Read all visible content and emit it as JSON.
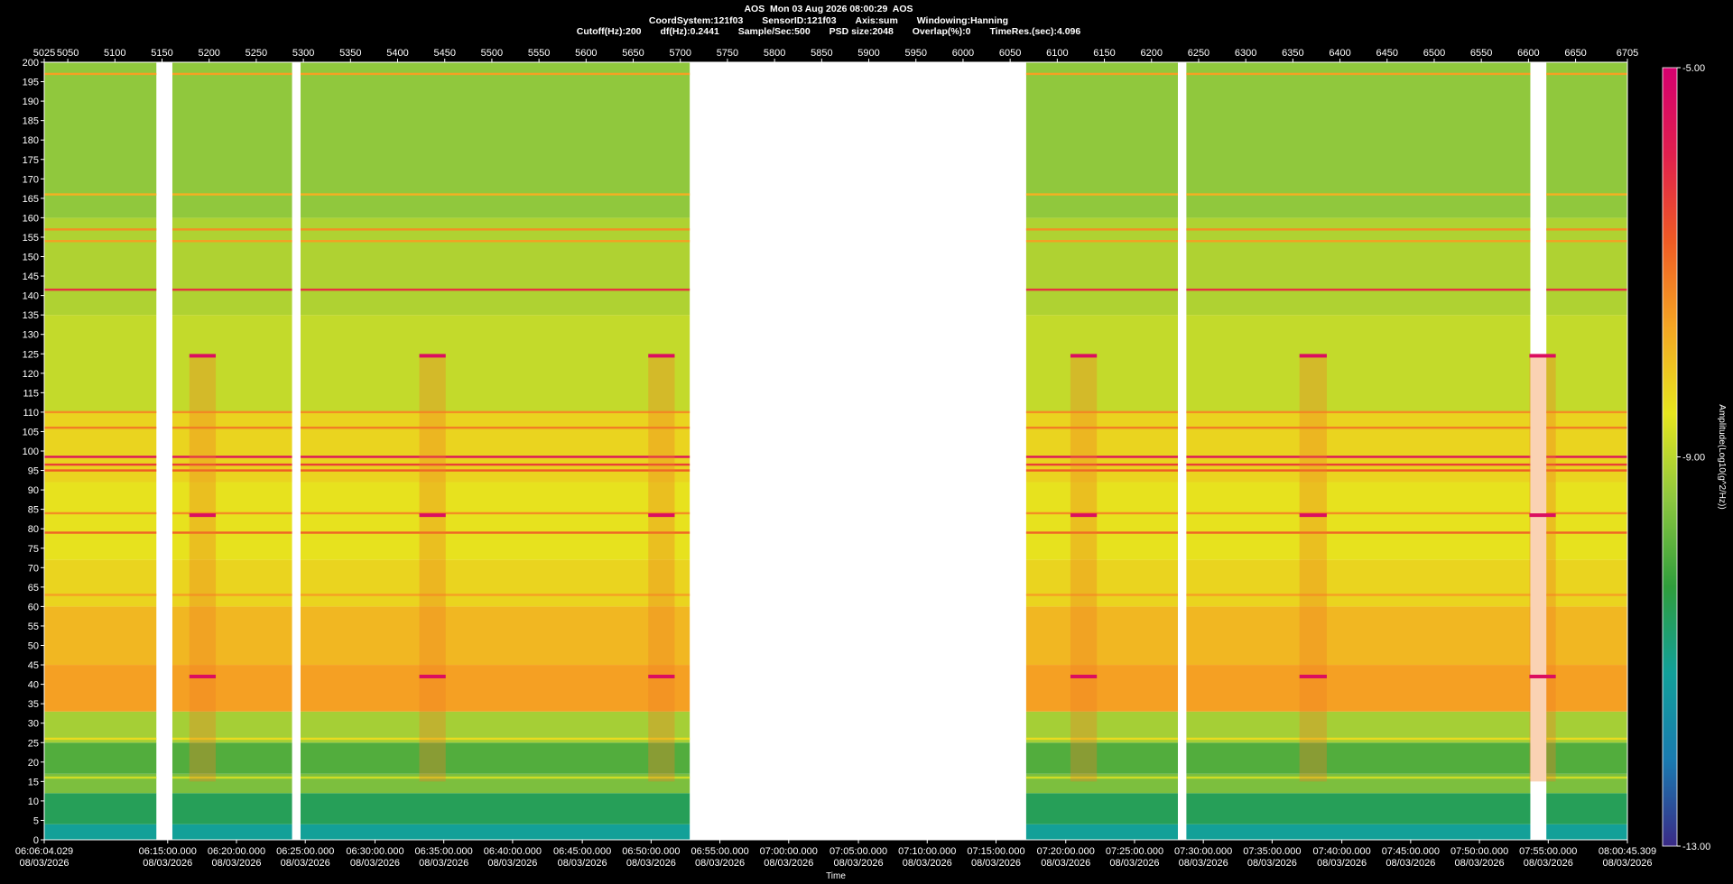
{
  "header": {
    "line1": "AOS  Mon 03 Aug 2026 08:00:29  AOS",
    "line2": [
      "CoordSystem:121f03",
      "SensorID:121f03",
      "Axis:sum",
      "Windowing:Hanning"
    ],
    "line3": [
      "Cutoff(Hz):200",
      "df(Hz):0.2441",
      "Sample/Sec:500",
      "PSD size:2048",
      "Overlap(%):0",
      "TimeRes.(sec):4.096"
    ]
  },
  "chart_data": {
    "type": "heatmap",
    "title": "AOS  Mon 03 Aug 2026 08:00:29  AOS",
    "xlabel": "Time",
    "ylabel": "",
    "colorbar_label": "Amplitude(Log10(g^2/Hz))",
    "colorbar_ticks": [
      "-5.00",
      "-9.00",
      "-13.00"
    ],
    "colorbar_range": [
      -13,
      -5
    ],
    "colorscale": [
      "#3a2a86",
      "#1a7bb0",
      "#12a09a",
      "#2f9e3c",
      "#8cc63f",
      "#e6e61e",
      "#f5a623",
      "#ef5a24",
      "#e01f4e",
      "#d6006f"
    ],
    "ylim": [
      0,
      200
    ],
    "y_ticks": [
      0,
      5,
      10,
      15,
      20,
      25,
      30,
      35,
      40,
      45,
      50,
      55,
      60,
      65,
      70,
      75,
      80,
      85,
      90,
      95,
      100,
      105,
      110,
      115,
      120,
      125,
      130,
      135,
      140,
      145,
      150,
      155,
      160,
      165,
      170,
      175,
      180,
      185,
      190,
      195,
      200
    ],
    "top_axis_range": [
      5025,
      6705
    ],
    "top_ticks": [
      "5025",
      "5050",
      "5100",
      "5150",
      "5200",
      "5250",
      "5300",
      "5350",
      "5400",
      "5450",
      "5500",
      "5550",
      "5600",
      "5650",
      "5700",
      "5750",
      "5800",
      "5850",
      "5900",
      "5950",
      "6000",
      "6050",
      "6100",
      "6150",
      "6200",
      "6250",
      "6300",
      "6350",
      "6400",
      "6450",
      "6500",
      "6550",
      "6600",
      "6650",
      "6705"
    ],
    "time_labels": [
      {
        "time": "06:06:04.029",
        "date": "08/03/2026",
        "pos": 5025
      },
      {
        "time": "06:15:00.000",
        "date": "08/03/2026",
        "pos": 5156
      },
      {
        "time": "06:20:00.000",
        "date": "08/03/2026",
        "pos": 5229
      },
      {
        "time": "06:25:00.000",
        "date": "08/03/2026",
        "pos": 5302
      },
      {
        "time": "06:30:00.000",
        "date": "08/03/2026",
        "pos": 5376
      },
      {
        "time": "06:35:00.000",
        "date": "08/03/2026",
        "pos": 5449
      },
      {
        "time": "06:40:00.000",
        "date": "08/03/2026",
        "pos": 5522
      },
      {
        "time": "06:45:00.000",
        "date": "08/03/2026",
        "pos": 5596
      },
      {
        "time": "06:50:00.000",
        "date": "08/03/2026",
        "pos": 5669
      },
      {
        "time": "06:55:00.000",
        "date": "08/03/2026",
        "pos": 5742
      },
      {
        "time": "07:00:00.000",
        "date": "08/03/2026",
        "pos": 5815
      },
      {
        "time": "07:05:00.000",
        "date": "08/03/2026",
        "pos": 5889
      },
      {
        "time": "07:10:00.000",
        "date": "08/03/2026",
        "pos": 5962
      },
      {
        "time": "07:15:00.000",
        "date": "08/03/2026",
        "pos": 6035
      },
      {
        "time": "07:20:00.000",
        "date": "08/03/2026",
        "pos": 6109
      },
      {
        "time": "07:25:00.000",
        "date": "08/03/2026",
        "pos": 6182
      },
      {
        "time": "07:30:00.000",
        "date": "08/03/2026",
        "pos": 6255
      },
      {
        "time": "07:35:00.000",
        "date": "08/03/2026",
        "pos": 6328
      },
      {
        "time": "07:40:00.000",
        "date": "08/03/2026",
        "pos": 6402
      },
      {
        "time": "07:45:00.000",
        "date": "08/03/2026",
        "pos": 6475
      },
      {
        "time": "07:50:00.000",
        "date": "08/03/2026",
        "pos": 6548
      },
      {
        "time": "07:55:00.000",
        "date": "08/03/2026",
        "pos": 6621
      },
      {
        "time": "08:00:45.309",
        "date": "08/03/2026",
        "pos": 6705
      }
    ],
    "data_gaps": [
      [
        5144,
        5161
      ],
      [
        5288,
        5297
      ],
      [
        5710,
        6067
      ],
      [
        6228,
        6237
      ],
      [
        6602,
        6619
      ]
    ],
    "spectral_bands": [
      {
        "f0": 0,
        "f1": 4,
        "level": -11.2
      },
      {
        "f0": 4,
        "f1": 12,
        "level": -10.6
      },
      {
        "f0": 12,
        "f1": 17,
        "level": -9.6
      },
      {
        "f0": 17,
        "f1": 25,
        "level": -10.0
      },
      {
        "f0": 25,
        "f1": 33,
        "level": -9.2
      },
      {
        "f0": 33,
        "f1": 45,
        "level": -7.6
      },
      {
        "f0": 45,
        "f1": 60,
        "level": -7.9
      },
      {
        "f0": 60,
        "f1": 72,
        "level": -8.3
      },
      {
        "f0": 72,
        "f1": 92,
        "level": -8.5
      },
      {
        "f0": 92,
        "f1": 110,
        "level": -8.3
      },
      {
        "f0": 110,
        "f1": 135,
        "level": -8.9
      },
      {
        "f0": 135,
        "f1": 160,
        "level": -9.1
      },
      {
        "f0": 160,
        "f1": 200,
        "level": -9.4
      }
    ],
    "tonal_lines": [
      {
        "freq": 197,
        "level": -7.6
      },
      {
        "freq": 166,
        "level": -7.8
      },
      {
        "freq": 157,
        "level": -7.4
      },
      {
        "freq": 154,
        "level": -7.6
      },
      {
        "freq": 141.5,
        "level": -6.2
      },
      {
        "freq": 110,
        "level": -7.4
      },
      {
        "freq": 106,
        "level": -7.2
      },
      {
        "freq": 98.5,
        "level": -5.6
      },
      {
        "freq": 96.5,
        "level": -6.4
      },
      {
        "freq": 95,
        "level": -6.8
      },
      {
        "freq": 84,
        "level": -7.4
      },
      {
        "freq": 79,
        "level": -6.9
      },
      {
        "freq": 63,
        "level": -7.6
      },
      {
        "freq": 26,
        "level": -8.4
      },
      {
        "freq": 16,
        "level": -8.8
      }
    ],
    "events": [
      {
        "x0": 5179,
        "x1": 5207,
        "freqs": [
          42,
          83.5,
          124.5
        ],
        "level": -5.4
      },
      {
        "x0": 5423,
        "x1": 5451,
        "freqs": [
          42,
          83.5,
          124.5
        ],
        "level": -5.4
      },
      {
        "x0": 5666,
        "x1": 5694,
        "freqs": [
          42,
          83.5,
          124.5
        ],
        "level": -5.4
      },
      {
        "x0": 6114,
        "x1": 6142,
        "freqs": [
          42,
          83.5,
          124.5
        ],
        "level": -5.4
      },
      {
        "x0": 6357,
        "x1": 6386,
        "freqs": [
          42,
          83.5,
          124.5
        ],
        "level": -5.4
      },
      {
        "x0": 6601,
        "x1": 6629,
        "freqs": [
          42,
          83.5,
          124.5
        ],
        "level": -5.4
      }
    ]
  }
}
